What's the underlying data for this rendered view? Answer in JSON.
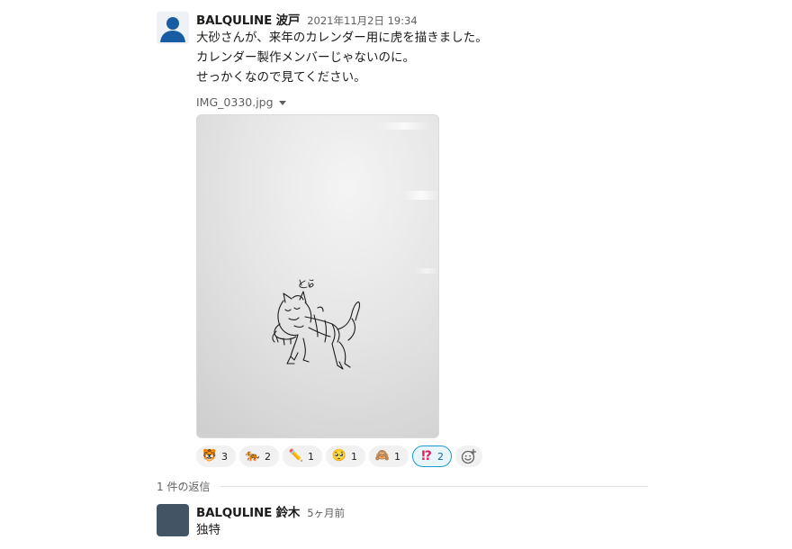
{
  "message": {
    "author": "BALQULINE 波戸",
    "timestamp": "2021年11月2日 19:34",
    "lines": [
      "大砂さんが、来年のカレンダー用に虎を描きました。",
      "カレンダー製作メンバーじゃないのに。",
      "せっかくなので見てください。"
    ],
    "attachment": {
      "filename": "IMG_0330.jpg",
      "handwritten_caption": "とら"
    }
  },
  "reactions": [
    {
      "emoji": "tiger-face",
      "glyph": "🐯",
      "count": "3",
      "active": false
    },
    {
      "emoji": "tiger",
      "glyph": "🐅",
      "count": "2",
      "active": false
    },
    {
      "emoji": "pencil",
      "glyph": "✏️",
      "count": "1",
      "active": false
    },
    {
      "emoji": "pleading-face",
      "glyph": "🥺",
      "count": "1",
      "active": false
    },
    {
      "emoji": "see-no-evil-monkey",
      "glyph": "🙈",
      "count": "1",
      "active": false
    },
    {
      "emoji": "interrobang",
      "glyph": "⁉",
      "count": "2",
      "active": true
    }
  ],
  "thread": {
    "reply_count_label": "1 件の返信"
  },
  "reply": {
    "author": "BALQULINE 鈴木",
    "timestamp": "5ヶ月前",
    "text": "独特"
  },
  "colors": {
    "accent": "#1264a3",
    "active_border": "#1d9bd1",
    "reply_avatar": "#435564",
    "default_avatar": "#1a5ca4"
  }
}
